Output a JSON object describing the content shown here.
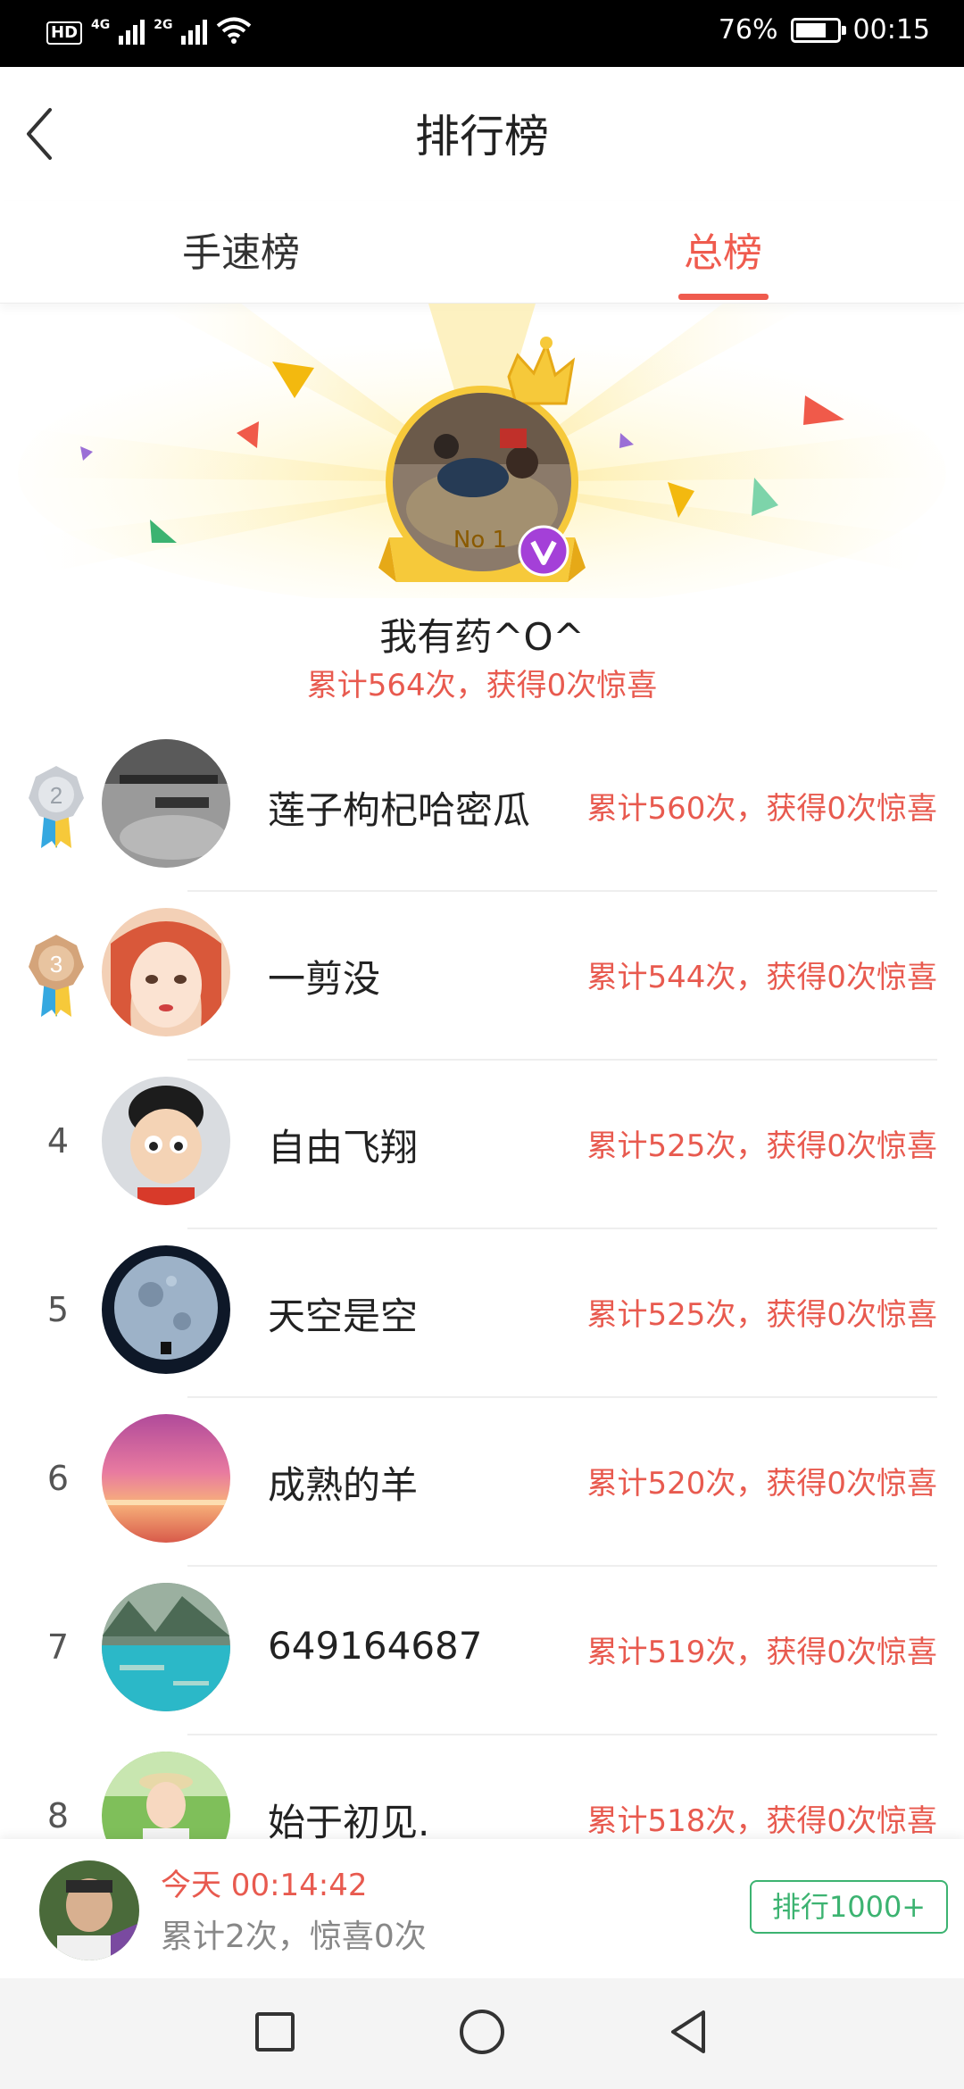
{
  "status_bar": {
    "hd_label": "HD",
    "network_1": "4G",
    "network_2": "2G",
    "battery": "76%",
    "battery_level": 0.76,
    "time": "00:15"
  },
  "header": {
    "title": "排行榜"
  },
  "tabs": [
    {
      "label": "手速榜",
      "active": false
    },
    {
      "label": "总榜",
      "active": true
    }
  ],
  "champion": {
    "badge": "No 1",
    "name": "我有药^O^",
    "stats": "累计564次，获得0次惊喜"
  },
  "ranking": [
    {
      "rank": "2",
      "name": "莲子枸杞哈密瓜",
      "stats": "累计560次，获得0次惊喜",
      "medal": "silver"
    },
    {
      "rank": "3",
      "name": "一剪没",
      "stats": "累计544次，获得0次惊喜",
      "medal": "bronze"
    },
    {
      "rank": "4",
      "name": "自由飞翔",
      "stats": "累计525次，获得0次惊喜"
    },
    {
      "rank": "5",
      "name": "天空是空",
      "stats": "累计525次，获得0次惊喜"
    },
    {
      "rank": "6",
      "name": "成熟的羊",
      "stats": "累计520次，获得0次惊喜"
    },
    {
      "rank": "7",
      "name": "649164687",
      "stats": "累计519次，获得0次惊喜"
    },
    {
      "rank": "8",
      "name": "始于初见.",
      "stats": "累计518次，获得0次惊喜"
    }
  ],
  "my_rank": {
    "time": "今天 00:14:42",
    "stats": "累计2次，惊喜0次",
    "rank_button": "排行1000+"
  },
  "colors": {
    "accent": "#ef5b4e",
    "green": "#3cb371",
    "gold": "#f6c93a"
  }
}
